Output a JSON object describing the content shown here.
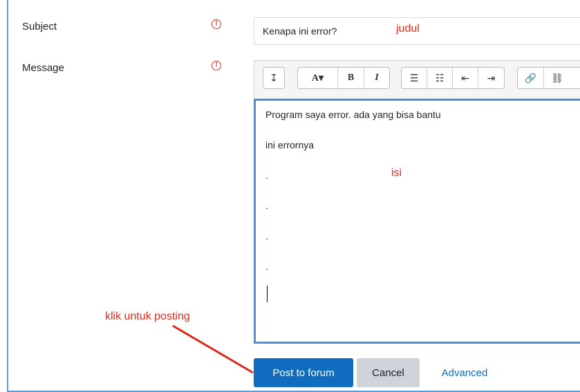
{
  "form": {
    "subject_label": "Subject",
    "message_label": "Message",
    "required_icon": "!",
    "subject_value": "Kenapa ini error?",
    "message_lines": [
      "Program saya error. ada yang bisa bantu",
      "ini errornya",
      ".",
      ".",
      ".",
      "."
    ]
  },
  "toolbar": {
    "collapse": "↧",
    "font": "A▾",
    "bold": "B",
    "italic": "I",
    "unordered_list": "☰",
    "ordered_list": "☷",
    "outdent": "⇤",
    "indent": "⇥",
    "link": "🔗",
    "unlink": "⛓"
  },
  "annotations": {
    "judul": "judul",
    "isi": "isi",
    "posting": "klik untuk posting"
  },
  "actions": {
    "post": "Post to forum",
    "cancel": "Cancel",
    "advanced": "Advanced"
  },
  "colors": {
    "primary": "#0f6cbf",
    "annotation": "#e0281a",
    "editor_focus": "#4a90d9"
  }
}
